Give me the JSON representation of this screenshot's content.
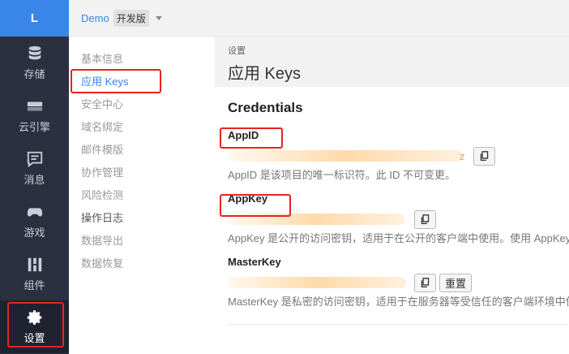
{
  "rail": {
    "logo": "L",
    "items": [
      {
        "label": "存储",
        "icon": "database-icon"
      },
      {
        "label": "云引擎",
        "icon": "server-icon"
      },
      {
        "label": "消息",
        "icon": "message-icon"
      },
      {
        "label": "游戏",
        "icon": "gamepad-icon"
      },
      {
        "label": "组件",
        "icon": "components-icon"
      },
      {
        "label": "设置",
        "icon": "gear-icon"
      }
    ]
  },
  "topbar": {
    "app_name": "Demo",
    "env": "开发版"
  },
  "subnav": {
    "items": [
      "基本信息",
      "应用 Keys",
      "安全中心",
      "域名绑定",
      "邮件模版",
      "协作管理",
      "风险检测",
      "操作日志",
      "数据导出",
      "数据恢复"
    ]
  },
  "page": {
    "crumb": "设置",
    "title": "应用 Keys"
  },
  "credentials": {
    "heading": "Credentials",
    "appid": {
      "label": "AppID",
      "tail": "z",
      "help": "AppID 是该项目的唯一标识符。此 ID 不可变更。"
    },
    "appkey": {
      "label": "AppKey",
      "help": "AppKey 是公开的访问密钥，适用于在公开的客户端中使用。使用 AppKey"
    },
    "masterkey": {
      "label": "MasterKey",
      "reset": "重置",
      "help": "MasterKey 是私密的访问密钥，适用于在服务器等受信任的客户端环境中使"
    }
  },
  "colors": {
    "accent": "#3a86e8",
    "sidebar": "#2b3040",
    "highlight": "#e52421"
  }
}
